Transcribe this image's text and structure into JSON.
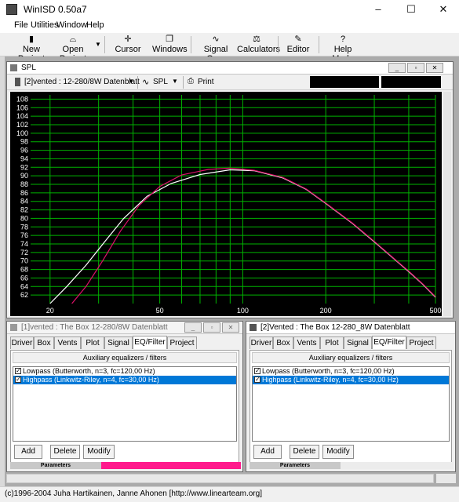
{
  "app": {
    "title": "WinISD 0.50a7",
    "window_controls": {
      "minimize": "–",
      "maximize": "☐",
      "close": "✕"
    }
  },
  "menu": [
    "File",
    "Utilities",
    "Window",
    "Help"
  ],
  "toolbar": [
    {
      "label": "New Project",
      "icon": "new-project-icon"
    },
    {
      "label": "Open Project",
      "icon": "open-project-icon"
    },
    {
      "label": "Cursor",
      "icon": "cursor-icon"
    },
    {
      "label": "Windows",
      "icon": "windows-icon"
    },
    {
      "label": "Signal Gen.",
      "icon": "signal-gen-icon"
    },
    {
      "label": "Calculators",
      "icon": "calculators-icon"
    },
    {
      "label": "Editor",
      "icon": "editor-icon"
    },
    {
      "label": "Help Mode",
      "icon": "help-mode-icon"
    }
  ],
  "spl_window": {
    "title": "SPL",
    "project_select": "[2]vented : 12-280/8W Datenblatt",
    "plot_select": "SPL",
    "print_label": "Print",
    "controls": {
      "minimize": "_",
      "restore": "▫",
      "close": "✕"
    }
  },
  "colors": {
    "grid": "#00b300",
    "curve_project1": "#ffffff",
    "curve_project2": "#e0106a",
    "selection_blue": "#0078d7",
    "accent_pink": "#ff1a8c",
    "chart_bg": "#000000"
  },
  "chart_data": {
    "type": "line",
    "title": "",
    "xlabel": "",
    "ylabel": "",
    "x_scale": "log",
    "xlim": [
      17,
      500
    ],
    "ylim": [
      60,
      109
    ],
    "y_ticks": [
      62,
      64,
      66,
      68,
      70,
      72,
      74,
      76,
      78,
      80,
      82,
      84,
      86,
      88,
      90,
      92,
      94,
      96,
      98,
      100,
      102,
      104,
      106,
      108
    ],
    "x_ticks": [
      20,
      50,
      100,
      200,
      500
    ],
    "grid": true,
    "series": [
      {
        "color": "#ffffff",
        "points": [
          [
            20,
            60
          ],
          [
            23,
            64
          ],
          [
            27,
            69
          ],
          [
            32,
            75
          ],
          [
            37,
            80
          ],
          [
            45,
            85.2
          ],
          [
            55,
            88.2
          ],
          [
            70,
            90.3
          ],
          [
            90,
            91.4
          ],
          [
            110,
            91.2
          ],
          [
            140,
            89.5
          ],
          [
            170,
            86.8
          ],
          [
            200,
            83.5
          ],
          [
            250,
            78.8
          ],
          [
            300,
            74.5
          ],
          [
            400,
            67.5
          ],
          [
            450,
            64.5
          ],
          [
            500,
            61.5
          ]
        ]
      },
      {
        "color": "#e0106a",
        "points": [
          [
            24,
            60
          ],
          [
            27,
            64
          ],
          [
            31,
            70
          ],
          [
            36,
            77
          ],
          [
            42,
            83
          ],
          [
            50,
            87.5
          ],
          [
            60,
            90.2
          ],
          [
            75,
            91.5
          ],
          [
            90,
            91.8
          ],
          [
            110,
            91.3
          ],
          [
            140,
            89.6
          ],
          [
            170,
            86.9
          ],
          [
            200,
            83.6
          ],
          [
            250,
            78.9
          ],
          [
            300,
            74.6
          ],
          [
            400,
            67.6
          ],
          [
            450,
            64.6
          ],
          [
            500,
            61.6
          ]
        ]
      }
    ]
  },
  "panel_left": {
    "title": "[1]vented : The Box 12-280/8W Datenblatt",
    "tabs": [
      "Driver",
      "Box",
      "Vents",
      "Plot",
      "Signal",
      "EQ/Filter",
      "Project"
    ],
    "selected_tab": "EQ/Filter",
    "section_header": "Auxiliary equalizers / filters",
    "filters": [
      {
        "label": "Lowpass (Butterworth, n=3, fc=120,00 Hz)",
        "checked": true,
        "selected": false
      },
      {
        "label": "Highpass (Linkwitz-Riley, n=4, fc=30,00 Hz)",
        "checked": true,
        "selected": true
      }
    ],
    "buttons": {
      "add": "Add",
      "delete": "Delete",
      "modify": "Modify"
    },
    "params_label": "Parameters",
    "controls": {
      "minimize": "_",
      "restore": "▫",
      "close": "✕"
    }
  },
  "panel_right": {
    "title": "[2]Vented : The Box 12-280_8W Datenblatt",
    "tabs": [
      "Driver",
      "Box",
      "Vents",
      "Plot",
      "Signal",
      "EQ/Filter",
      "Project"
    ],
    "selected_tab": "EQ/Filter",
    "section_header": "Auxiliary equalizers / filters",
    "filters": [
      {
        "label": "Lowpass (Butterworth, n=3, fc=120,00 Hz)",
        "checked": true,
        "selected": false
      },
      {
        "label": "Highpass (Linkwitz-Riley, n=4, fc=30,00 Hz)",
        "checked": true,
        "selected": true
      }
    ],
    "buttons": {
      "add": "Add",
      "delete": "Delete",
      "modify": "Modify"
    },
    "params_label": "Parameters"
  },
  "status": "(c)1996-2004 Juha Hartikainen, Janne Ahonen [http://www.linearteam.org]"
}
